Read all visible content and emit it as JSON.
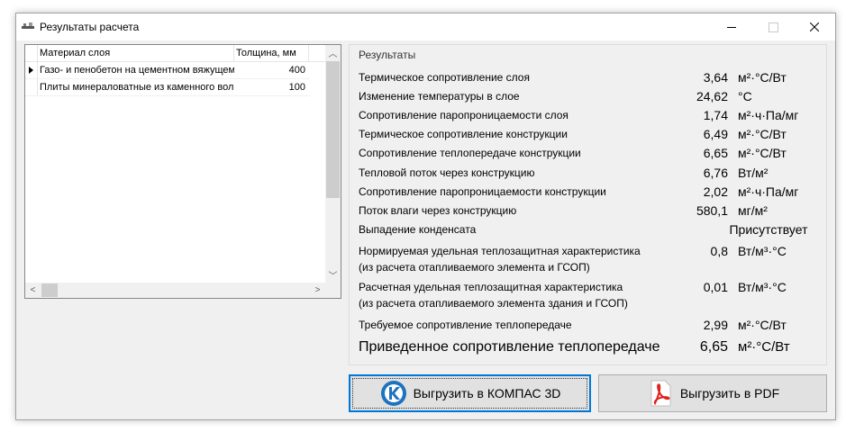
{
  "window": {
    "title": "Результаты расчета"
  },
  "grid": {
    "columns": [
      "Материал слоя",
      "Толщина, мм"
    ],
    "rows": [
      {
        "material": "Газо- и пенобетон на цементном вяжущем",
        "thickness": "400",
        "current": true
      },
      {
        "material": "Плиты минераловатные из каменного волокна",
        "thickness": "100",
        "current": false
      }
    ]
  },
  "results": {
    "title": "Результаты",
    "rows": [
      {
        "label": "Термическое сопротивление слоя",
        "value": "3,64",
        "unit": "м²·°С/Вт"
      },
      {
        "label": "Изменение температуры в слое",
        "value": "24,62",
        "unit": "°С"
      },
      {
        "label": "Сопротивление паропроницаемости слоя",
        "value": "1,74",
        "unit": "м²·ч·Па/мг"
      },
      {
        "label": "Термическое сопротивление конструкции",
        "value": "6,49",
        "unit": "м²·°С/Вт"
      },
      {
        "label": "Сопротивление теплопередаче конструкции",
        "value": "6,65",
        "unit": "м²·°С/Вт"
      },
      {
        "label": "Тепловой поток через конструкцию",
        "value": "6,76",
        "unit": "Вт/м²"
      },
      {
        "label": "Сопротивление паропроницаемости конструкции",
        "value": "2,02",
        "unit": "м²·ч·Па/мг"
      },
      {
        "label": "Поток влаги через конструкцию",
        "value": "580,1",
        "unit": "мг/м²"
      }
    ],
    "condensate": {
      "label": "Выпадение конденсата",
      "value": "Присутствует"
    },
    "norm_char": {
      "label1": "Нормируемая удельная теплозащитная характеристика",
      "label2": "(из расчета отапливаемого элемента и ГСОП)",
      "value": "0,8",
      "unit": "Вт/м³·°С"
    },
    "calc_char": {
      "label1": "Расчетная удельная теплозащитная характеристика",
      "label2": "(из расчета отапливаемого элемента здания и ГСОП)",
      "value": "0,01",
      "unit": "Вт/м³·°С"
    },
    "required": {
      "label": "Требуемое сопротивление теплопередаче",
      "value": "2,99",
      "unit": "м²·°С/Вт"
    },
    "reduced": {
      "label": "Приведенное сопротивление теплопередаче",
      "value": "6,65",
      "unit": "м²·°С/Вт"
    }
  },
  "buttons": {
    "kompas": {
      "label": "Выгрузить в КОМПАС 3D",
      "icon": "kompas-icon"
    },
    "pdf": {
      "label": "Выгрузить в PDF",
      "icon": "pdf-icon"
    }
  },
  "colors": {
    "accent": "#0078d7",
    "pdf_red": "#e0201c",
    "kompas_blue": "#1e73be"
  }
}
